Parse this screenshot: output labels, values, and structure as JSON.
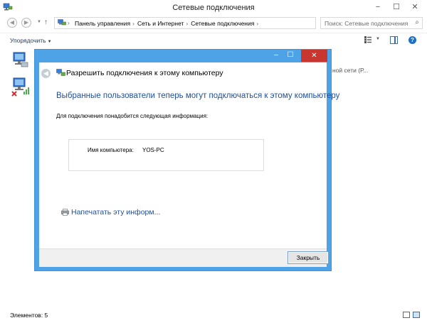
{
  "explorer": {
    "title": "Сетевые подключения",
    "breadcrumbs": [
      "Панель управления",
      "Сеть и Интернет",
      "Сетевые подключения"
    ],
    "search_placeholder": "Поиск: Сетевые подключения",
    "organize_label": "Упорядочить",
    "partial_text": "ной сети (Р...",
    "status_text": "Элементов: 5"
  },
  "dialog": {
    "title": "Разрешить подключения к этому компьютеру",
    "main_instruction": "Выбранные пользователи теперь могут подключаться к этому компьютеру",
    "info_label": "Для подключения понадобится следующая информация:",
    "computer_name_label": "Имя компьютера:",
    "computer_name_value": "YOS-PC",
    "print_link": "Напечатать эту информ...",
    "close_button": "Закрыть"
  },
  "colors": {
    "dialog_frame": "#4da3e6",
    "close_red": "#c7372f",
    "link_blue": "#1f4e9a"
  },
  "icons": [
    "network-connections-icon",
    "back-icon",
    "forward-icon",
    "up-arrow-icon",
    "refresh-icon",
    "search-icon",
    "help-icon",
    "printer-icon",
    "network-adapter-icon"
  ]
}
